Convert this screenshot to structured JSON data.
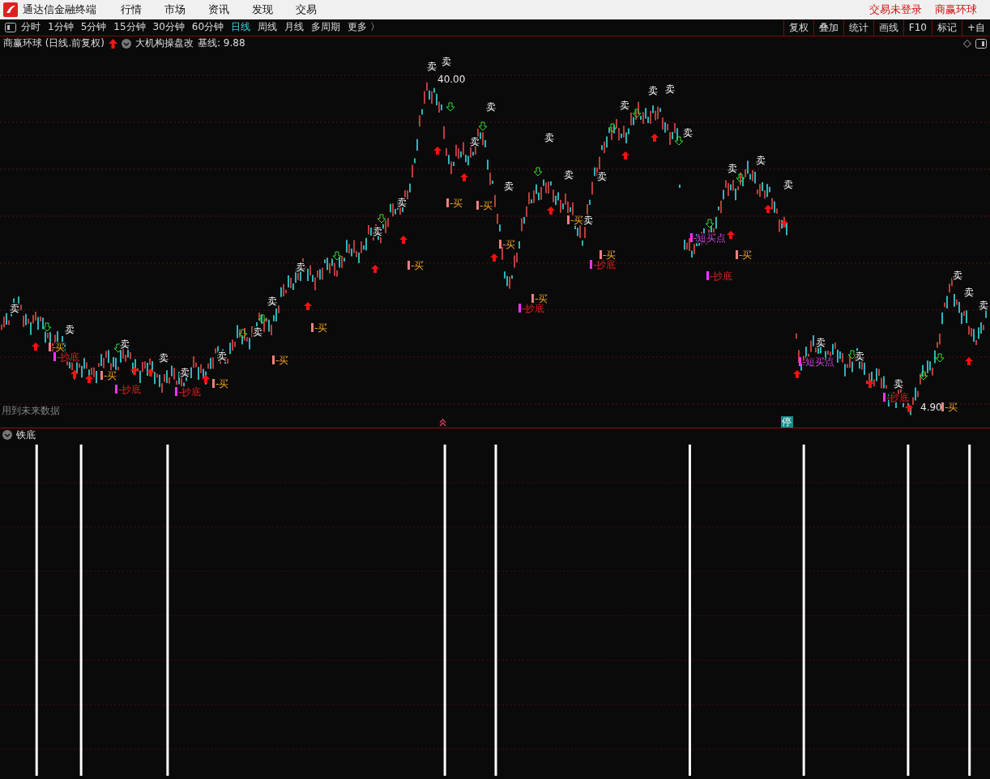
{
  "app": {
    "title": "通达信金融终端",
    "menu": [
      "行情",
      "市场",
      "资讯",
      "发现",
      "交易"
    ],
    "status": [
      "交易未登录",
      "商赢环球"
    ]
  },
  "periods": [
    {
      "label": "分时",
      "selected": false
    },
    {
      "label": "1分钟",
      "selected": false
    },
    {
      "label": "5分钟",
      "selected": false
    },
    {
      "label": "15分钟",
      "selected": false
    },
    {
      "label": "30分钟",
      "selected": false
    },
    {
      "label": "60分钟",
      "selected": false
    },
    {
      "label": "日线",
      "selected": true
    },
    {
      "label": "周线",
      "selected": false
    },
    {
      "label": "月线",
      "selected": false
    },
    {
      "label": "多周期",
      "selected": false
    }
  ],
  "more": "更多 〉",
  "tools": [
    "复权",
    "叠加",
    "统计",
    "画线",
    "F10",
    "标记",
    "+自"
  ],
  "chart": {
    "title": "商赢环球 (日线.前复权)",
    "indicator": "大机构操盘改",
    "baseline": "基线: 9.88",
    "price_high": "40.00",
    "price_low": "4.90",
    "notice": "用到未来数据",
    "halt_badge": "停",
    "signals": [
      {
        "kind": "sell",
        "text": "卖"
      },
      {
        "kind": "sell",
        "text": "卖"
      },
      {
        "kind": "sell",
        "text": "卖"
      },
      {
        "kind": "sell",
        "text": "卖"
      },
      {
        "kind": "sell",
        "text": "卖"
      },
      {
        "kind": "sell",
        "text": "卖"
      },
      {
        "kind": "sell",
        "text": "卖"
      },
      {
        "kind": "sell",
        "text": "卖"
      },
      {
        "kind": "sell",
        "text": "卖"
      },
      {
        "kind": "sell",
        "text": "卖"
      },
      {
        "kind": "sell",
        "text": "卖"
      },
      {
        "kind": "sell",
        "text": "卖"
      },
      {
        "kind": "sell",
        "text": "卖"
      },
      {
        "kind": "sell",
        "text": "卖"
      },
      {
        "kind": "sell",
        "text": "卖"
      },
      {
        "kind": "sell",
        "text": "卖"
      },
      {
        "kind": "sell",
        "text": "卖"
      },
      {
        "kind": "sell",
        "text": "卖"
      },
      {
        "kind": "sell",
        "text": "卖"
      },
      {
        "kind": "sell",
        "text": "卖"
      },
      {
        "kind": "sell",
        "text": "卖"
      },
      {
        "kind": "sell",
        "text": "卖"
      },
      {
        "kind": "sell",
        "text": "卖"
      },
      {
        "kind": "sell",
        "text": "卖"
      },
      {
        "kind": "sell",
        "text": "卖"
      },
      {
        "kind": "sell",
        "text": "卖"
      },
      {
        "kind": "sell",
        "text": "卖"
      },
      {
        "kind": "sell",
        "text": "卖"
      },
      {
        "kind": "sell",
        "text": "卖"
      },
      {
        "kind": "sell",
        "text": "卖"
      },
      {
        "kind": "sell",
        "text": "卖"
      },
      {
        "kind": "sell",
        "text": "卖"
      },
      {
        "kind": "sell",
        "text": "卖"
      },
      {
        "kind": "buy",
        "text": "-买"
      },
      {
        "kind": "buy",
        "text": "-买"
      },
      {
        "kind": "buy",
        "text": "-买"
      },
      {
        "kind": "buy",
        "text": "-买"
      },
      {
        "kind": "buy",
        "text": "-买"
      },
      {
        "kind": "buy",
        "text": "-买"
      },
      {
        "kind": "buy",
        "text": "-买"
      },
      {
        "kind": "buy",
        "text": "-买"
      },
      {
        "kind": "buy",
        "text": "-买"
      },
      {
        "kind": "buy",
        "text": "-买"
      },
      {
        "kind": "buy",
        "text": "-买"
      },
      {
        "kind": "buy",
        "text": "-买"
      },
      {
        "kind": "buy",
        "text": "-买"
      },
      {
        "kind": "buy",
        "text": "-买"
      },
      {
        "kind": "bottom",
        "text": "-抄底"
      },
      {
        "kind": "bottom",
        "text": "-抄底"
      },
      {
        "kind": "bottom",
        "text": "-抄底"
      },
      {
        "kind": "bottom",
        "text": "-抄底"
      },
      {
        "kind": "bottom",
        "text": "-抄底"
      },
      {
        "kind": "bottom",
        "text": "-抄底"
      },
      {
        "kind": "bottom",
        "text": "-抄底"
      },
      {
        "kind": "short",
        "text": "-短买点"
      },
      {
        "kind": "short",
        "text": "-短买点"
      }
    ]
  },
  "sub_chart": {
    "title": "铁底"
  }
}
